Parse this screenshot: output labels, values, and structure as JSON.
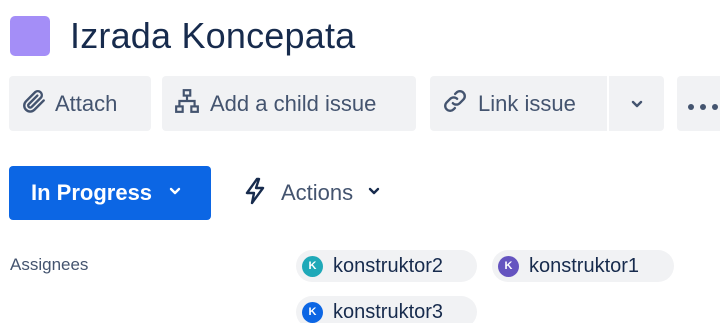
{
  "issue": {
    "title": "Izrada Koncepata",
    "type_icon_color": "#a48ef7"
  },
  "toolbar": {
    "attach_label": "Attach",
    "attach_icon": "paperclip-icon",
    "child_label": "Add a child issue",
    "child_icon": "hierarchy-icon",
    "link_label": "Link issue",
    "link_icon": "link-icon",
    "link_dropdown_icon": "chevron-down-icon",
    "more_icon": "more-icon"
  },
  "status": {
    "label": "In Progress",
    "color": "#0c66e4"
  },
  "actions": {
    "label": "Actions",
    "icon": "lightning-icon"
  },
  "assignees": {
    "label": "Assignees",
    "users": [
      {
        "initial": "K",
        "name": "konstruktor2",
        "color": "#1fa9b8"
      },
      {
        "initial": "K",
        "name": "konstruktor1",
        "color": "#6554c0"
      },
      {
        "initial": "K",
        "name": "konstruktor3",
        "color": "#0c66e4"
      }
    ]
  }
}
